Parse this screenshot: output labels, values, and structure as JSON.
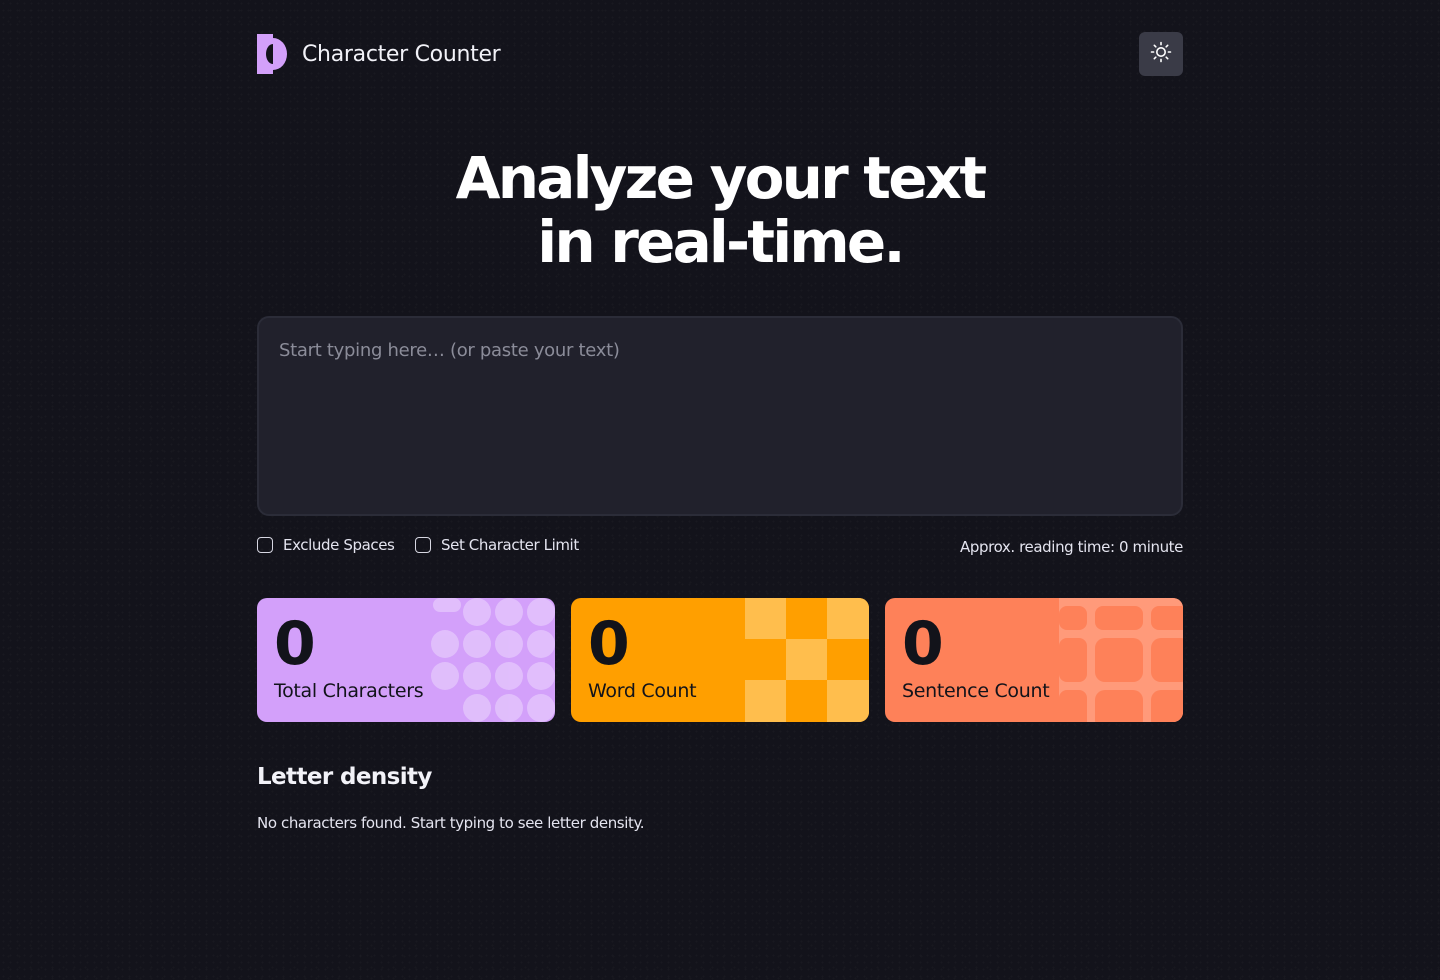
{
  "header": {
    "app_title": "Character Counter",
    "logo_icon": "half-circle-logo-icon",
    "theme_toggle_icon": "sun-icon"
  },
  "hero": {
    "line1": "Analyze your text",
    "line2": "in real-time."
  },
  "input": {
    "placeholder": "Start typing here… (or paste your text)",
    "value": ""
  },
  "options": {
    "exclude_spaces_label": "Exclude Spaces",
    "exclude_spaces_checked": false,
    "char_limit_label": "Set Character Limit",
    "char_limit_checked": false,
    "reading_time": "Approx. reading time: 0 minute"
  },
  "stats": [
    {
      "value": "0",
      "label": "Total Characters",
      "color": "#d3a0fa"
    },
    {
      "value": "0",
      "label": "Word Count",
      "color": "#ff9f00"
    },
    {
      "value": "0",
      "label": "Sentence Count",
      "color": "#fe8159"
    }
  ],
  "density": {
    "title": "Letter density",
    "empty_message": "No characters found. Start typing to see letter density."
  },
  "colors": {
    "background": "#13131b",
    "surface": "#21212c",
    "accent_purple": "#d3a0fa",
    "accent_yellow": "#ff9f00",
    "accent_orange": "#fe8159"
  }
}
